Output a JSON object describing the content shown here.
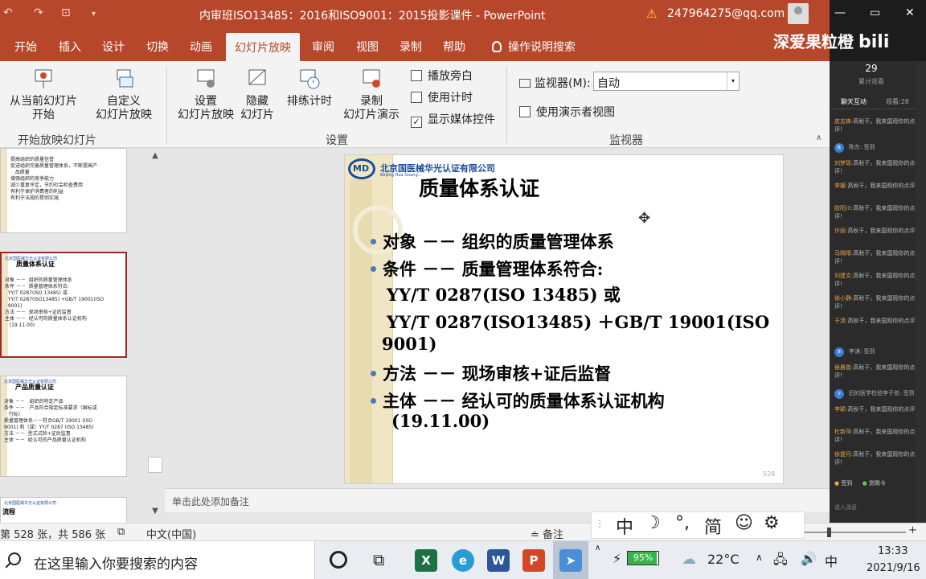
{
  "titlebar": {
    "title": "内审班ISO13485：2016和ISO9001：2015投影课件  -  PowerPoint",
    "user": "247964275@qq.com",
    "warning_icon": "warning-icon"
  },
  "tabs": [
    "开始",
    "插入",
    "设计",
    "切换",
    "动画",
    "幻灯片放映",
    "审阅",
    "视图",
    "录制",
    "帮助",
    "操作说明搜索"
  ],
  "ribbon": {
    "start_group": {
      "from_current": "从当前幻灯片\n开始",
      "custom_show": "自定义\n幻灯片放映",
      "label": "开始放映幻灯片"
    },
    "setup_group": {
      "setup_show": "设置\n幻灯片放映",
      "hide_slide": "隐藏\n幻灯片",
      "rehearse": "排练计时",
      "record": "录制\n幻灯片演示",
      "play_narration": "播放旁白",
      "use_timings": "使用计时",
      "show_media": "显示媒体控件",
      "label": "设置"
    },
    "monitor_group": {
      "monitor_label": "监视器(M):",
      "monitor_value": "自动",
      "presenter_view": "使用演示者视图",
      "label": "监视器"
    }
  },
  "thumbnails": [
    {
      "title": "",
      "lines": "提高组织的质量信誉\n促进组织完善质量管理体系，不断提高产\n   品质量\n增强组织的竞争能力\n减少重复评定，节约社会检查费用\n有利于保护消费者的利益\n有利于法规的贯彻实施"
    },
    {
      "title": "质量体系认证",
      "lines": "对象 －－  组织的质量管理体系\n条件 －－  质量管理体系符合:\n  YY/T 0287(ISO 13485) 或\n  YY/T 0287(ISO13485) +GB/T 19001(ISO\n  9001)\n方法 －－  现场审核+证后监督\n主体 －－  经认可的质量体系认证机构\n   (19.11.00)"
    },
    {
      "title": "产品质量认证",
      "lines": "对象 －－   组织的特定产品\n条件 －－   产品符合指定标准要求（国标或\n   行标）\n质量管理体系－－符合GB/T 19001 (ISO\n9001) 和（或）YY/T 0287 (ISO 13485)\n方法 －－  型式试验+证后监督\n主体 －－  经认可的产品质量认证机构"
    },
    {
      "title": "流程",
      "lines": ""
    }
  ],
  "slide": {
    "company": "北京国医械华光认证有限公司",
    "company_en": "Beijing Hua Guang...",
    "title": "质量体系认证",
    "bullets": [
      "对象 －－  组织的质量管理体系",
      "条件 －－  质量管理体系符合:",
      "方法 －－  现场审核+证后监督",
      "主体 －－  经认可的质量体系认证机构"
    ],
    "sub_lines": [
      "YY/T 0287(ISO 13485) 或",
      "YY/T 0287(ISO13485) ＋GB/T 19001(ISO",
      "9001)",
      "(19.11.00)"
    ],
    "page_number": "528"
  },
  "notes_placeholder": "单击此处添加备注",
  "statusbar": {
    "slide_count": "第 528 张，共 586 张",
    "language": "中文(中国)",
    "notes": "备注"
  },
  "ime": {
    "mode": "中",
    "moon": "☽",
    "punct": "°,",
    "simp": "简",
    "emoji": "☺",
    "gear": "⚙"
  },
  "taskbar": {
    "search_placeholder": "在这里输入你要搜索的内容",
    "battery": "95%",
    "temperature": "22°C",
    "ime_indicator": "中",
    "time": "13:33",
    "date": "2021/9/16"
  },
  "chat": {
    "viewers": "29",
    "viewers_label": "累计观看",
    "tab_chat": "聊天互动",
    "tab_viewers": "观看:28",
    "messages": [
      {
        "name": "皮志锋:",
        "text": "高秋干。我来国观你的点评！"
      },
      {
        "name": "陈东:",
        "text": "签到"
      },
      {
        "name": "刘梦瑶:",
        "text": "高秋干，我来国观你的点评！"
      },
      {
        "name": "李媛:",
        "text": "高秋干，我来国观你的点评！"
      },
      {
        "name": "欧阳川:",
        "text": "高秋干，我来国观你的点评！"
      },
      {
        "name": "许丽:",
        "text": "高秋干，我来国观你的点评！"
      },
      {
        "name": "马晓晴:",
        "text": "高秋干，我来国观你的点评！"
      },
      {
        "name": "刘建文:",
        "text": "高秋干，我来国观你的点评！"
      },
      {
        "name": "徐小静:",
        "text": "高秋干，我来国观你的点评！"
      },
      {
        "name": "于清:",
        "text": "高秋干，我来国观你的点评！"
      },
      {
        "name": "李涛:",
        "text": "签到"
      },
      {
        "name": "侯晨曾:",
        "text": "高秋干，我来国观你的点评！"
      },
      {
        "name": "旧的医学检验李子依:",
        "text": "签到"
      },
      {
        "name": "李颖:",
        "text": "高秋干，我来国观你的点评！"
      },
      {
        "name": "杜新萍:",
        "text": "高秋干，我来国观你的点评！"
      },
      {
        "name": "徐提月:",
        "text": "高秋干，我来国观你的点评！"
      }
    ],
    "signin": "签到",
    "reward": "赏赐卡",
    "enter": "说入消息"
  },
  "watermark": "深爱果粒橙",
  "watermark_logo": "bili"
}
